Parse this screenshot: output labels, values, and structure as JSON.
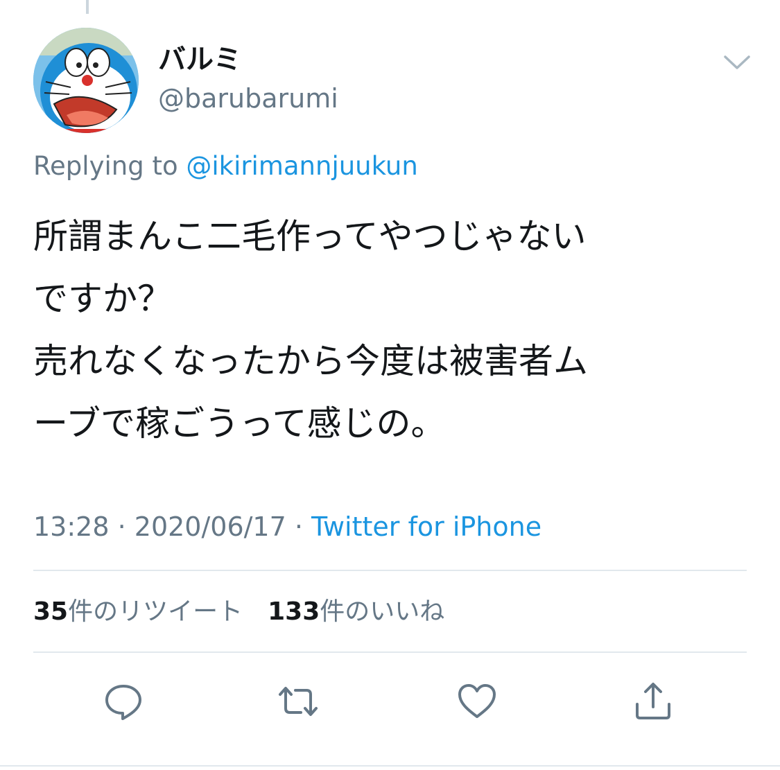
{
  "tweet": {
    "author": {
      "display_name": "バルミ",
      "handle": "@barubarumi"
    },
    "reply": {
      "prefix": "Replying to ",
      "mention": "@ikirimannjuukun"
    },
    "text_lines": [
      "所謂まんこ二毛作ってやつじゃない",
      "ですか？",
      "売れなくなったから今度は被害者ム",
      "ーブで稼ごうって感じの。"
    ],
    "meta": {
      "time": "13:28",
      "separator": " · ",
      "date": "2020/06/17",
      "source": "Twitter for iPhone"
    },
    "stats": {
      "retweet_count": "35",
      "retweet_label": "件のリツイート",
      "like_count": "133",
      "like_label": "件のいいね"
    }
  },
  "icons": {
    "caret": "chevron-down-icon",
    "reply": "reply-icon",
    "retweet": "retweet-icon",
    "like": "heart-icon",
    "share": "share-icon"
  },
  "colors": {
    "text": "#14171a",
    "secondary": "#657786",
    "link": "#1b95e0",
    "divider": "#e1e8ed"
  }
}
